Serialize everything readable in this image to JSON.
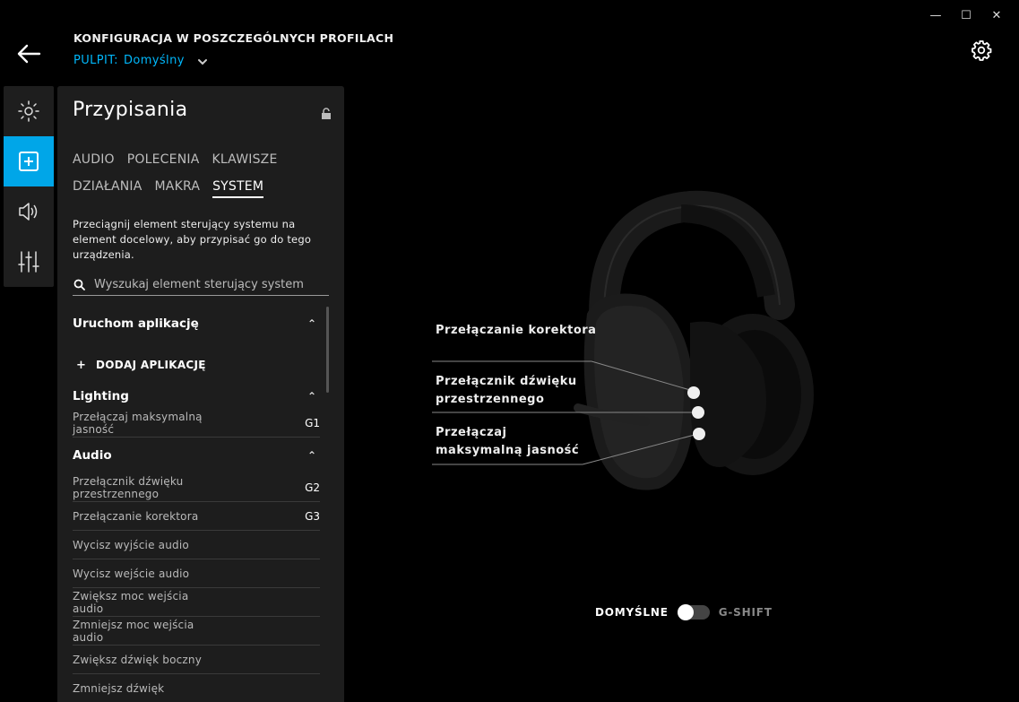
{
  "window": {
    "minimize": "—",
    "maximize": "☐",
    "close": "✕"
  },
  "header": {
    "title": "KONFIGURACJA W POSZCZEGÓLNYCH PROFILACH",
    "profile_prefix": "PULPIT:",
    "profile_name": "Domyślny"
  },
  "rail": {
    "items": [
      {
        "icon": "lightsync-icon",
        "active": false
      },
      {
        "icon": "assignments-icon",
        "active": true
      },
      {
        "icon": "audio-icon",
        "active": false
      },
      {
        "icon": "equalizer-icon",
        "active": false
      }
    ]
  },
  "panel": {
    "title": "Przypisania",
    "tabs_row1": [
      "AUDIO",
      "POLECENIA",
      "KLAWISZE"
    ],
    "tabs_row2": [
      "DZIAŁANIA",
      "MAKRA",
      "SYSTEM"
    ],
    "active_tab": "SYSTEM",
    "description": "Przeciągnij element sterujący systemu na element docelowy, aby przypisać go do tego urządzenia.",
    "search_placeholder": "Wyszukaj element sterujący system",
    "sections": {
      "launch": {
        "title": "Uruchom aplikację",
        "add_label": "DODAJ APLIKACJĘ"
      },
      "lighting": {
        "title": "Lighting",
        "items": [
          {
            "label": "Przełączaj maksymalną jasność",
            "key": "G1"
          }
        ]
      },
      "audio": {
        "title": "Audio",
        "items": [
          {
            "label": "Przełącznik dźwięku przestrzennego",
            "key": "G2"
          },
          {
            "label": "Przełączanie korektora",
            "key": "G3"
          },
          {
            "label": "Wycisz wyjście audio",
            "key": ""
          },
          {
            "label": "Wycisz wejście audio",
            "key": ""
          },
          {
            "label": "Zwiększ moc wejścia audio",
            "key": ""
          },
          {
            "label": "Zmniejsz moc wejścia audio",
            "key": ""
          },
          {
            "label": "Zwiększ dźwięk boczny",
            "key": ""
          },
          {
            "label": "Zmniejsz dźwięk",
            "key": ""
          }
        ]
      }
    }
  },
  "device": {
    "callouts": [
      "Przełączanie korektora",
      "Przełącznik dźwięku przestrzennego",
      "Przełączaj maksymalną jasność"
    ]
  },
  "mode": {
    "left": "DOMYŚLNE",
    "right": "G-SHIFT",
    "gshift_on": false
  }
}
